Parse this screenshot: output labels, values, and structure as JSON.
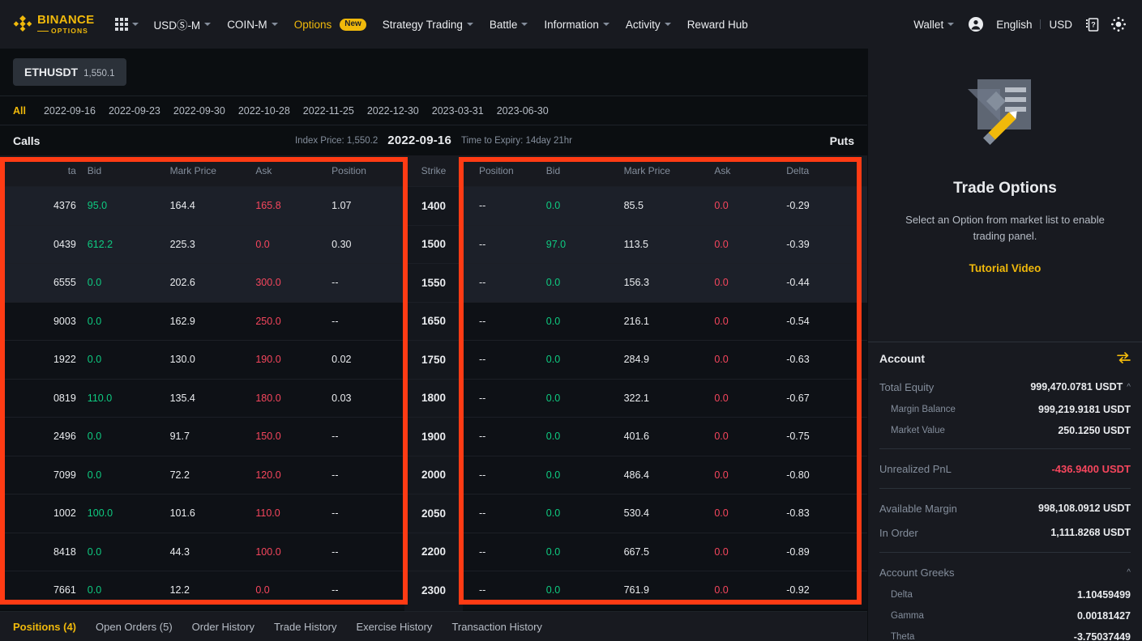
{
  "topnav": {
    "brand": {
      "title": "BINANCE",
      "subtitle": "OPTIONS"
    },
    "apps_icon": "grid-apps-icon",
    "items": [
      {
        "label": "USDⓈ-M",
        "caret": true
      },
      {
        "label": "COIN-M",
        "caret": true
      },
      {
        "label": "Options",
        "caret": false,
        "badge": "New"
      },
      {
        "label": "Strategy Trading",
        "caret": true
      },
      {
        "label": "Battle",
        "caret": true
      },
      {
        "label": "Information",
        "caret": true
      },
      {
        "label": "Activity",
        "caret": true
      },
      {
        "label": "Reward Hub",
        "caret": false
      }
    ],
    "wallet": "Wallet",
    "profile_icon": "user-avatar-icon",
    "language": "English",
    "currency": "USD",
    "download_icon": "qr-download-app-icon",
    "theme_icon": "sun-brightness-icon"
  },
  "symbolbar": {
    "symbol": "ETHUSDT",
    "price": "1,550.1"
  },
  "datebar": {
    "tabs": [
      {
        "label": "All",
        "active": true
      },
      {
        "label": "2022-09-16",
        "active": false
      },
      {
        "label": "2022-09-23",
        "active": false
      },
      {
        "label": "2022-09-30",
        "active": false
      },
      {
        "label": "2022-10-28",
        "active": false
      },
      {
        "label": "2022-11-25",
        "active": false
      },
      {
        "label": "2022-12-30",
        "active": false
      },
      {
        "label": "2023-03-31",
        "active": false
      },
      {
        "label": "2023-06-30",
        "active": false
      }
    ]
  },
  "chain_header": {
    "calls_label": "Calls",
    "puts_label": "Puts",
    "index_price": "Index Price: 1,550.2",
    "expiry_date": "2022-09-16",
    "time_to_expiry": "Time to Expiry: 14day 21hr"
  },
  "chain": {
    "calls_columns": [
      "ta",
      "Bid",
      "Mark Price",
      "Ask",
      "Position"
    ],
    "strike_column": "Strike",
    "puts_columns": [
      "Position",
      "Bid",
      "Mark Price",
      "Ask",
      "Delta"
    ],
    "rows": [
      {
        "strike": "1400",
        "itm": true,
        "call": {
          "delta": "4376",
          "bid": "95.0",
          "mark": "164.4",
          "ask": "165.8",
          "position": "1.07"
        },
        "put": {
          "position": "--",
          "bid": "0.0",
          "mark": "85.5",
          "ask": "0.0",
          "delta": "-0.29"
        }
      },
      {
        "strike": "1500",
        "itm": true,
        "call": {
          "delta": "0439",
          "bid": "612.2",
          "mark": "225.3",
          "ask": "0.0",
          "position": "0.30"
        },
        "put": {
          "position": "--",
          "bid": "97.0",
          "mark": "113.5",
          "ask": "0.0",
          "delta": "-0.39"
        }
      },
      {
        "strike": "1550",
        "itm": true,
        "call": {
          "delta": "6555",
          "bid": "0.0",
          "mark": "202.6",
          "ask": "300.0",
          "position": "--"
        },
        "put": {
          "position": "--",
          "bid": "0.0",
          "mark": "156.3",
          "ask": "0.0",
          "delta": "-0.44"
        }
      },
      {
        "strike": "1650",
        "itm": false,
        "call": {
          "delta": "9003",
          "bid": "0.0",
          "mark": "162.9",
          "ask": "250.0",
          "position": "--"
        },
        "put": {
          "position": "--",
          "bid": "0.0",
          "mark": "216.1",
          "ask": "0.0",
          "delta": "-0.54"
        }
      },
      {
        "strike": "1750",
        "itm": false,
        "call": {
          "delta": "1922",
          "bid": "0.0",
          "mark": "130.0",
          "ask": "190.0",
          "position": "0.02"
        },
        "put": {
          "position": "--",
          "bid": "0.0",
          "mark": "284.9",
          "ask": "0.0",
          "delta": "-0.63"
        }
      },
      {
        "strike": "1800",
        "itm": false,
        "call": {
          "delta": "0819",
          "bid": "110.0",
          "mark": "135.4",
          "ask": "180.0",
          "position": "0.03"
        },
        "put": {
          "position": "--",
          "bid": "0.0",
          "mark": "322.1",
          "ask": "0.0",
          "delta": "-0.67"
        }
      },
      {
        "strike": "1900",
        "itm": false,
        "call": {
          "delta": "2496",
          "bid": "0.0",
          "mark": "91.7",
          "ask": "150.0",
          "position": "--"
        },
        "put": {
          "position": "--",
          "bid": "0.0",
          "mark": "401.6",
          "ask": "0.0",
          "delta": "-0.75"
        }
      },
      {
        "strike": "2000",
        "itm": false,
        "call": {
          "delta": "7099",
          "bid": "0.0",
          "mark": "72.2",
          "ask": "120.0",
          "position": "--"
        },
        "put": {
          "position": "--",
          "bid": "0.0",
          "mark": "486.4",
          "ask": "0.0",
          "delta": "-0.80"
        }
      },
      {
        "strike": "2050",
        "itm": false,
        "call": {
          "delta": "1002",
          "bid": "100.0",
          "mark": "101.6",
          "ask": "110.0",
          "position": "--"
        },
        "put": {
          "position": "--",
          "bid": "0.0",
          "mark": "530.4",
          "ask": "0.0",
          "delta": "-0.83"
        }
      },
      {
        "strike": "2200",
        "itm": false,
        "call": {
          "delta": "8418",
          "bid": "0.0",
          "mark": "44.3",
          "ask": "100.0",
          "position": "--"
        },
        "put": {
          "position": "--",
          "bid": "0.0",
          "mark": "667.5",
          "ask": "0.0",
          "delta": "-0.89"
        }
      },
      {
        "strike": "2300",
        "itm": false,
        "call": {
          "delta": "7661",
          "bid": "0.0",
          "mark": "12.2",
          "ask": "0.0",
          "position": "--"
        },
        "put": {
          "position": "--",
          "bid": "0.0",
          "mark": "761.9",
          "ask": "0.0",
          "delta": "-0.92"
        }
      }
    ]
  },
  "bottom_tabs": [
    {
      "label": "Positions (4)",
      "active": true
    },
    {
      "label": "Open Orders (5)",
      "active": false
    },
    {
      "label": "Order History",
      "active": false
    },
    {
      "label": "Trade History",
      "active": false
    },
    {
      "label": "Exercise History",
      "active": false
    },
    {
      "label": "Transaction History",
      "active": false
    }
  ],
  "trade_panel": {
    "illustration": "document-pencil-illustration",
    "title": "Trade Options",
    "description": "Select an Option from market list to enable trading panel.",
    "link": "Tutorial Video"
  },
  "account": {
    "title": "Account",
    "swap_icon": "transfer-swap-icon",
    "total_equity_label": "Total Equity",
    "total_equity_value": "999,470.0781 USDT",
    "margin_balance_label": "Margin Balance",
    "margin_balance_value": "999,219.9181 USDT",
    "market_value_label": "Market Value",
    "market_value_value": "250.1250 USDT",
    "unrealized_pnl_label": "Unrealized PnL",
    "unrealized_pnl_value": "-436.9400 USDT",
    "available_margin_label": "Available Margin",
    "available_margin_value": "998,108.0912 USDT",
    "in_order_label": "In Order",
    "in_order_value": "1,111.8268 USDT",
    "greeks_title": "Account Greeks",
    "greeks": [
      {
        "label": "Delta",
        "value": "1.10459499"
      },
      {
        "label": "Gamma",
        "value": "0.00181427"
      },
      {
        "label": "Theta",
        "value": "-3.75037449"
      }
    ]
  },
  "colors": {
    "brand": "#f0b90b",
    "up": "#0ecb81",
    "down": "#f6465d",
    "annotation": "#ff3b14",
    "bg": "#0b0e11",
    "panel": "#181a20"
  }
}
